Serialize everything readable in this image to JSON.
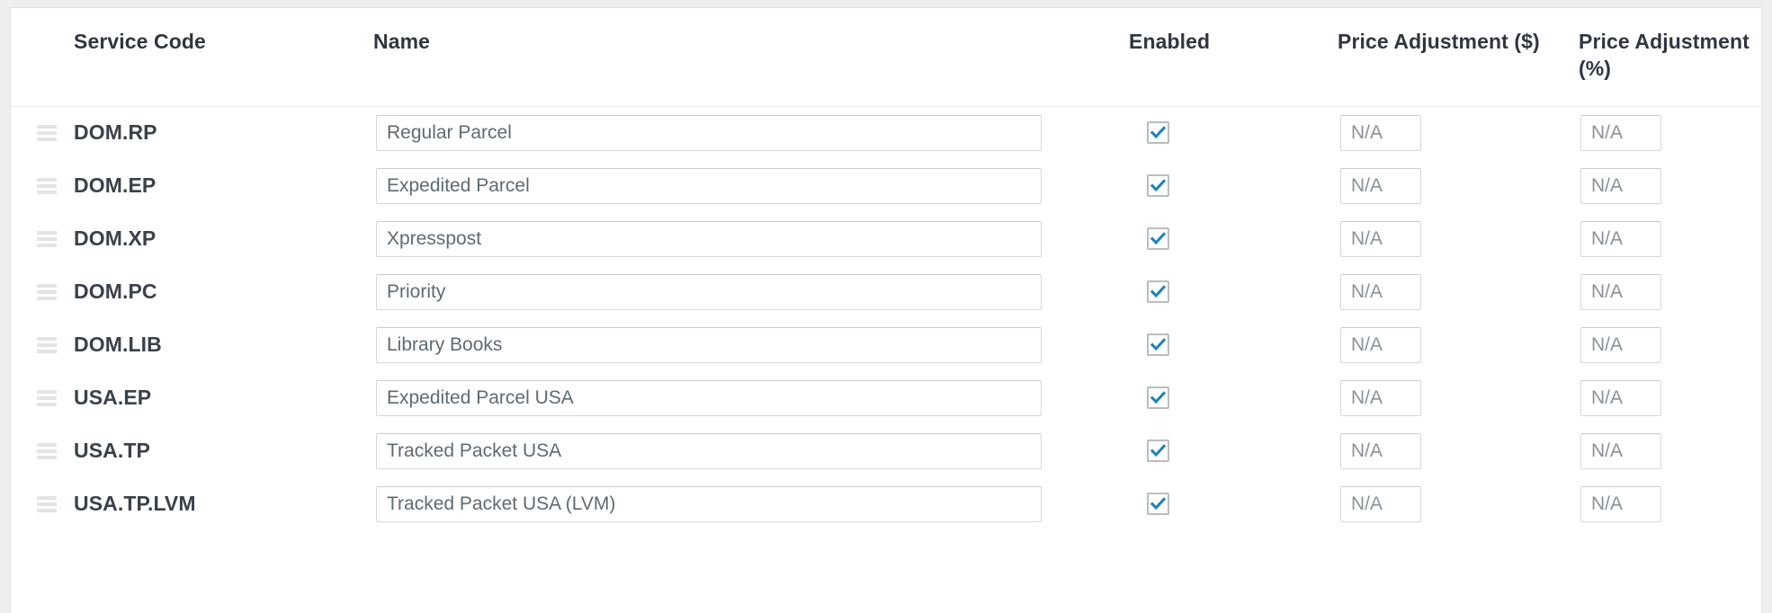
{
  "table": {
    "columns": [
      {
        "key": "handle",
        "label": "",
        "icon": "drag-handle-icon"
      },
      {
        "key": "code",
        "label": "Service Code"
      },
      {
        "key": "name",
        "label": "Name"
      },
      {
        "key": "enabled",
        "label": "Enabled"
      },
      {
        "key": "price_adjustment_dollar",
        "label": "Price Adjustment ($)"
      },
      {
        "key": "price_adjustment_percent",
        "label": "Price Adjustment (%)"
      }
    ],
    "rows": [
      {
        "code": "DOM.RP",
        "name": "Regular Parcel",
        "enabled": true,
        "price_adjustment_dollar": "N/A",
        "price_adjustment_percent": "N/A"
      },
      {
        "code": "DOM.EP",
        "name": "Expedited Parcel",
        "enabled": true,
        "price_adjustment_dollar": "N/A",
        "price_adjustment_percent": "N/A"
      },
      {
        "code": "DOM.XP",
        "name": "Xpresspost",
        "enabled": true,
        "price_adjustment_dollar": "N/A",
        "price_adjustment_percent": "N/A"
      },
      {
        "code": "DOM.PC",
        "name": "Priority",
        "enabled": true,
        "price_adjustment_dollar": "N/A",
        "price_adjustment_percent": "N/A"
      },
      {
        "code": "DOM.LIB",
        "name": "Library Books",
        "enabled": true,
        "price_adjustment_dollar": "N/A",
        "price_adjustment_percent": "N/A"
      },
      {
        "code": "USA.EP",
        "name": "Expedited Parcel USA",
        "enabled": true,
        "price_adjustment_dollar": "N/A",
        "price_adjustment_percent": "N/A"
      },
      {
        "code": "USA.TP",
        "name": "Tracked Packet USA",
        "enabled": true,
        "price_adjustment_dollar": "N/A",
        "price_adjustment_percent": "N/A"
      },
      {
        "code": "USA.TP.LVM",
        "name": "Tracked Packet USA (LVM)",
        "enabled": true,
        "price_adjustment_dollar": "N/A",
        "price_adjustment_percent": "N/A"
      }
    ]
  },
  "colors": {
    "page_background": "#eeeeee",
    "card_background": "#ffffff",
    "header_text": "#2f3640",
    "code_text": "#3a4149",
    "input_text": "#5f6a72",
    "input_border": "#d5d8db",
    "checkbox_accent": "#1d84b5",
    "checkbox_border": "#b9bdc1",
    "drag_handle": "#e3e4e6"
  }
}
